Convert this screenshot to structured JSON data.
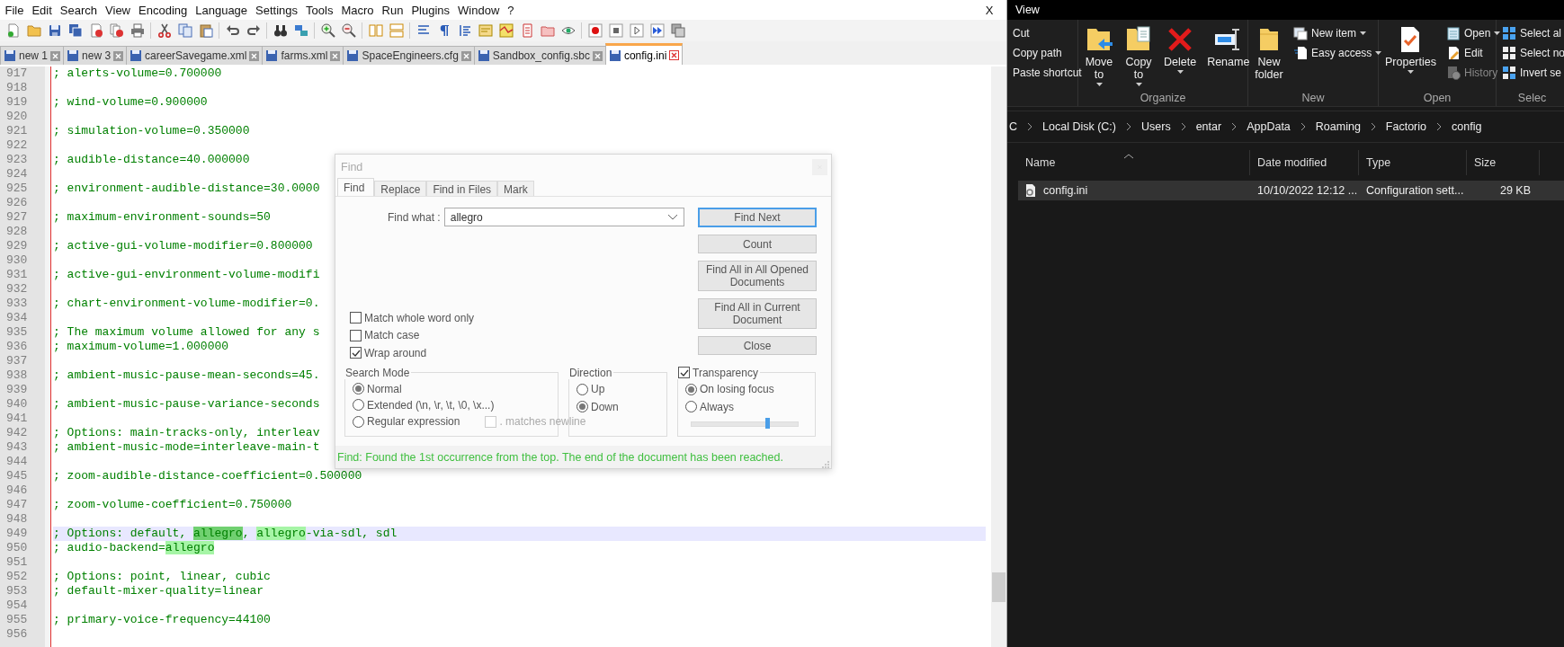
{
  "menu": {
    "items": [
      "File",
      "Edit",
      "Search",
      "View",
      "Encoding",
      "Language",
      "Settings",
      "Tools",
      "Macro",
      "Run",
      "Plugins",
      "Window",
      "?"
    ],
    "close": "X"
  },
  "tabs": [
    {
      "label": "new 1",
      "selected": false
    },
    {
      "label": "new 3",
      "selected": false
    },
    {
      "label": "careerSavegame.xml",
      "selected": false
    },
    {
      "label": "farms.xml",
      "selected": false
    },
    {
      "label": "SpaceEngineers.cfg",
      "selected": false
    },
    {
      "label": "Sandbox_config.sbc",
      "selected": false
    },
    {
      "label": "config.ini",
      "selected": true
    }
  ],
  "editor": {
    "lines": [
      {
        "number": "917",
        "current": false,
        "text": "; alerts-volume=0.700000"
      },
      {
        "number": "918",
        "current": false
      },
      {
        "number": "919",
        "current": false,
        "text": "; wind-volume=0.900000"
      },
      {
        "number": "920",
        "current": false
      },
      {
        "number": "921",
        "current": false,
        "text": "; simulation-volume=0.350000"
      },
      {
        "number": "922",
        "current": false
      },
      {
        "number": "923",
        "current": false,
        "text": "; audible-distance=40.000000"
      },
      {
        "number": "924",
        "current": false
      },
      {
        "number": "925",
        "current": false,
        "text": "; environment-audible-distance=30.0000"
      },
      {
        "number": "926",
        "current": false
      },
      {
        "number": "927",
        "current": false,
        "text": "; maximum-environment-sounds=50"
      },
      {
        "number": "928",
        "current": false
      },
      {
        "number": "929",
        "current": false,
        "text": "; active-gui-volume-modifier=0.800000"
      },
      {
        "number": "930",
        "current": false
      },
      {
        "number": "931",
        "current": false,
        "text": "; active-gui-environment-volume-modifi"
      },
      {
        "number": "932",
        "current": false
      },
      {
        "number": "933",
        "current": false,
        "text": "; chart-environment-volume-modifier=0."
      },
      {
        "number": "934",
        "current": false
      },
      {
        "number": "935",
        "current": false,
        "text": "; The maximum volume allowed for any s"
      },
      {
        "number": "936",
        "current": false,
        "text": "; maximum-volume=1.000000"
      },
      {
        "number": "937",
        "current": false
      },
      {
        "number": "938",
        "current": false,
        "text": "; ambient-music-pause-mean-seconds=45."
      },
      {
        "number": "939",
        "current": false
      },
      {
        "number": "940",
        "current": false,
        "text": "; ambient-music-pause-variance-seconds"
      },
      {
        "number": "941",
        "current": false
      },
      {
        "number": "942",
        "current": false,
        "text": "; Options: main-tracks-only, interleav"
      },
      {
        "number": "943",
        "current": false,
        "text": "; ambient-music-mode=interleave-main-t"
      },
      {
        "number": "944",
        "current": false
      },
      {
        "number": "945",
        "current": false,
        "text": "; zoom-audible-distance-coefficient=0.500000"
      },
      {
        "number": "946",
        "current": false
      },
      {
        "number": "947",
        "current": false,
        "text": "; zoom-volume-coefficient=0.750000"
      },
      {
        "number": "948",
        "current": false
      },
      {
        "number": "949",
        "current": true,
        "segments": [
          {
            "text": "; Options: default, ",
            "kind": "plain"
          },
          {
            "text": "allegro",
            "kind": "selected"
          },
          {
            "text": ", ",
            "kind": "plain"
          },
          {
            "text": "allegro",
            "kind": "match"
          },
          {
            "text": "-via-sdl, sdl",
            "kind": "plain"
          }
        ]
      },
      {
        "number": "950",
        "current": false,
        "segments": [
          {
            "text": "; audio-backend=",
            "kind": "plain"
          },
          {
            "text": "allegro",
            "kind": "match"
          }
        ]
      },
      {
        "number": "951",
        "current": false
      },
      {
        "number": "952",
        "current": false,
        "text": "; Options: point, linear, cubic"
      },
      {
        "number": "953",
        "current": false,
        "text": "; default-mixer-quality=linear"
      },
      {
        "number": "954",
        "current": false
      },
      {
        "number": "955",
        "current": false,
        "text": "; primary-voice-frequency=44100"
      },
      {
        "number": "956",
        "current": false
      }
    ]
  },
  "find_dialog": {
    "title": "Find",
    "tabs": [
      {
        "label": "Find",
        "selected": true
      },
      {
        "label": "Replace",
        "selected": false
      },
      {
        "label": "Find in Files",
        "selected": false
      },
      {
        "label": "Mark",
        "selected": false
      }
    ],
    "find_what_label": "Find what :",
    "find_what_value": "allegro",
    "buttons": [
      {
        "label": "Find Next",
        "default": true
      },
      {
        "label": "Count",
        "default": false
      },
      {
        "label": "Find All in All Opened Documents",
        "default": false
      },
      {
        "label": "Find All in Current Document",
        "default": false
      },
      {
        "label": "Close",
        "default": false
      }
    ],
    "options": [
      {
        "label": "Match whole word only",
        "checked": false
      },
      {
        "label": "Match case",
        "checked": false
      },
      {
        "label": "Wrap around",
        "checked": true
      }
    ],
    "search_mode": {
      "title": "Search Mode",
      "options": [
        {
          "label": "Normal",
          "selected": true
        },
        {
          "label": "Extended (\\n, \\r, \\t, \\0, \\x...)",
          "selected": false
        },
        {
          "label": "Regular expression",
          "selected": false
        }
      ],
      "dot_newline": {
        "label": ". matches newline",
        "checked": false,
        "disabled": true
      }
    },
    "direction": {
      "title": "Direction",
      "options": [
        {
          "label": "Up",
          "selected": false
        },
        {
          "label": "Down",
          "selected": true
        }
      ]
    },
    "transparency": {
      "label": "Transparency",
      "checked": true,
      "options": [
        {
          "label": "On losing focus",
          "selected": true
        },
        {
          "label": "Always",
          "selected": false
        }
      ],
      "level": 0.71
    },
    "status": "Find: Found the 1st occurrence from the top. The end of the document has been reached."
  },
  "explorer": {
    "ribbon_tab": "View",
    "groups": [
      {
        "items": [
          {
            "label": "Cut",
            "kind": "small",
            "dropdown": false,
            "disabled": false
          },
          {
            "label": "Copy path",
            "kind": "small",
            "dropdown": false,
            "disabled": false
          },
          {
            "label": "Paste shortcut",
            "kind": "small",
            "dropdown": false,
            "disabled": false
          }
        ]
      },
      {
        "label": "Organize",
        "items": [
          {
            "label": "Move to",
            "kind": "large",
            "dropdown": true,
            "disabled": false
          },
          {
            "label": "Copy to",
            "kind": "large",
            "dropdown": true,
            "disabled": false
          },
          {
            "label": "Delete",
            "kind": "large",
            "dropdown": true,
            "disabled": false
          },
          {
            "label": "Rename",
            "kind": "large",
            "dropdown": false,
            "disabled": false
          }
        ]
      },
      {
        "label": "New",
        "items": [
          {
            "label": "New folder",
            "kind": "large",
            "dropdown": false,
            "disabled": false
          },
          {
            "label": "New item",
            "kind": "small",
            "dropdown": true,
            "disabled": false
          },
          {
            "label": "Easy access",
            "kind": "small",
            "dropdown": true,
            "disabled": false
          }
        ]
      },
      {
        "label": "Open",
        "items": [
          {
            "label": "Properties",
            "kind": "large",
            "dropdown": true,
            "disabled": false
          },
          {
            "label": "Open",
            "kind": "small",
            "dropdown": true,
            "disabled": false
          },
          {
            "label": "Edit",
            "kind": "small",
            "dropdown": false,
            "disabled": false
          },
          {
            "label": "History",
            "kind": "small",
            "dropdown": false,
            "disabled": true
          }
        ]
      },
      {
        "label": "Selec",
        "items": [
          {
            "label": "Select al",
            "kind": "small",
            "dropdown": false,
            "disabled": false
          },
          {
            "label": "Select no",
            "kind": "small",
            "dropdown": false,
            "disabled": false
          },
          {
            "label": "Invert se",
            "kind": "small",
            "dropdown": false,
            "disabled": false
          }
        ]
      }
    ],
    "address": [
      "C",
      "Local Disk (C:)",
      "Users",
      "entar",
      "AppData",
      "Roaming",
      "Factorio",
      "config"
    ],
    "columns": [
      {
        "label": "Name",
        "sorted": true
      },
      {
        "label": "Date modified",
        "sorted": false
      },
      {
        "label": "Type",
        "sorted": false
      },
      {
        "label": "Size",
        "sorted": false
      }
    ],
    "files": [
      {
        "name": "config.ini",
        "date": "10/10/2022 12:12 ...",
        "type": "Configuration sett...",
        "size": "29 KB",
        "selected": true
      }
    ]
  }
}
